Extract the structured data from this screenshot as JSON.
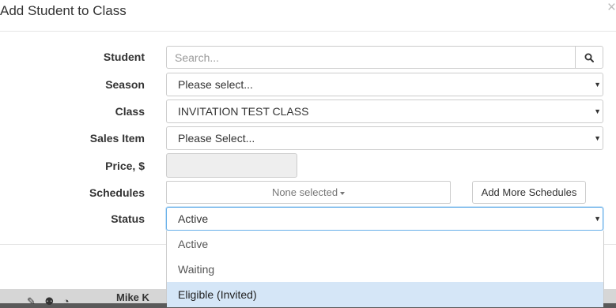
{
  "modal": {
    "title": "Add Student to Class",
    "close_glyph": "×"
  },
  "form": {
    "student": {
      "label": "Student",
      "placeholder": "Search...",
      "button_icon": "search-icon"
    },
    "season": {
      "label": "Season",
      "value": "Please select..."
    },
    "class": {
      "label": "Class",
      "value": "INVITATION TEST CLASS"
    },
    "sales_item": {
      "label": "Sales Item",
      "value": "Please Select..."
    },
    "price": {
      "label": "Price, $",
      "value": ""
    },
    "schedules": {
      "label": "Schedules",
      "value": "None selected",
      "add_button": "Add More Schedules"
    },
    "status": {
      "label": "Status",
      "value": "Active",
      "options": [
        "Active",
        "Waiting",
        "Eligible (Invited)"
      ],
      "highlighted": "Eligible (Invited)"
    }
  },
  "background": {
    "user_name": "Mike K",
    "button_fragment": "s"
  },
  "colors": {
    "highlight": "#d5e6f7",
    "focus_border": "#66afe9",
    "primary_button": "#3a86c8"
  }
}
